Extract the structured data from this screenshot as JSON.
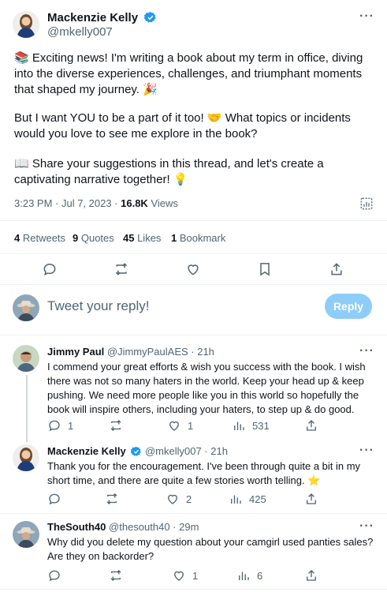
{
  "main_tweet": {
    "author_name": "Mackenzie Kelly",
    "author_handle": "@mkelly007",
    "para1": "📚 Exciting news! I'm writing a book about my term in office, diving into the diverse experiences, challenges, and triumphant moments that shaped my journey. 🎉",
    "para2": "But I want YOU to be a part of it too! 🤝 What topics or incidents would you love to see me explore in the book?",
    "para3": "📖 Share your suggestions in this thread, and let's create a captivating narrative together! 💡",
    "timestamp": "3:23 PM · Jul 7, 2023 · ",
    "views_count": "16.8K",
    "views_label": " Views",
    "retweets_count": "4",
    "retweets_label": " Retweets",
    "quotes_count": "9",
    "quotes_label": " Quotes",
    "likes_count": "45",
    "likes_label": " Likes",
    "bookmarks_count": "1",
    "bookmarks_label": " Bookmark"
  },
  "composer": {
    "placeholder": "Tweet your reply!",
    "reply_label": "Reply"
  },
  "replies": [
    {
      "name": "Jimmy Paul",
      "handle": "@JimmyPaulAES · 21h",
      "text": "I commend your great efforts & wish you success with the book.  I wish there was not so many haters in the world.  Keep your head up & keep pushing.  We need more people like you in this world so hopefully the book will inspire others, including your haters, to step up & do good.",
      "replies": "1",
      "retweets": "",
      "likes": "1",
      "views": "531"
    },
    {
      "name": "Mackenzie Kelly",
      "handle": "@mkelly007 · 21h",
      "text": "Thank you for the encouragement. I've been through quite a bit in my short time, and there are quite a few stories worth telling. ⭐",
      "replies": "",
      "retweets": "",
      "likes": "2",
      "views": "425"
    },
    {
      "name": "TheSouth40",
      "handle": "@thesouth40 · 29m",
      "text": "Why did you delete my question about your camgirl used panties sales? Are they on backorder?",
      "replies": "",
      "retweets": "",
      "likes": "1",
      "views": "6"
    }
  ],
  "colors": {
    "verified": "#1d9bf0",
    "muted": "#536471",
    "reply_button": "#8ecdf8"
  }
}
